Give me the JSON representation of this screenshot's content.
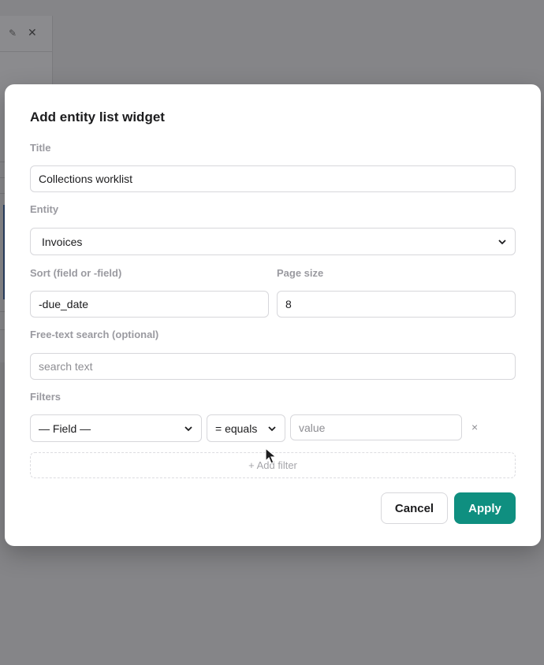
{
  "background": {
    "edit_icon": "pencil-icon",
    "close_icon": "close-icon"
  },
  "dialog": {
    "title": "Add entity list widget",
    "fields": {
      "title": {
        "label": "Title",
        "value": "Collections worklist"
      },
      "entity": {
        "label": "Entity",
        "value": "Invoices"
      },
      "sort": {
        "label": "Sort (field or -field)",
        "value": "-due_date"
      },
      "page_size": {
        "label": "Page size",
        "value": "8"
      },
      "search": {
        "label": "Free-text search (optional)",
        "value": "",
        "placeholder": "search text"
      }
    },
    "filters": {
      "label": "Filters",
      "rows": [
        {
          "field": "— Field —",
          "operator": "= equals",
          "value": "",
          "value_placeholder": "value",
          "remove": "×"
        }
      ],
      "add_label": "+ Add filter"
    },
    "actions": {
      "cancel": "Cancel",
      "apply": "Apply"
    }
  },
  "colors": {
    "accent": "#0f8f80",
    "overlay": "#7f7f81"
  }
}
